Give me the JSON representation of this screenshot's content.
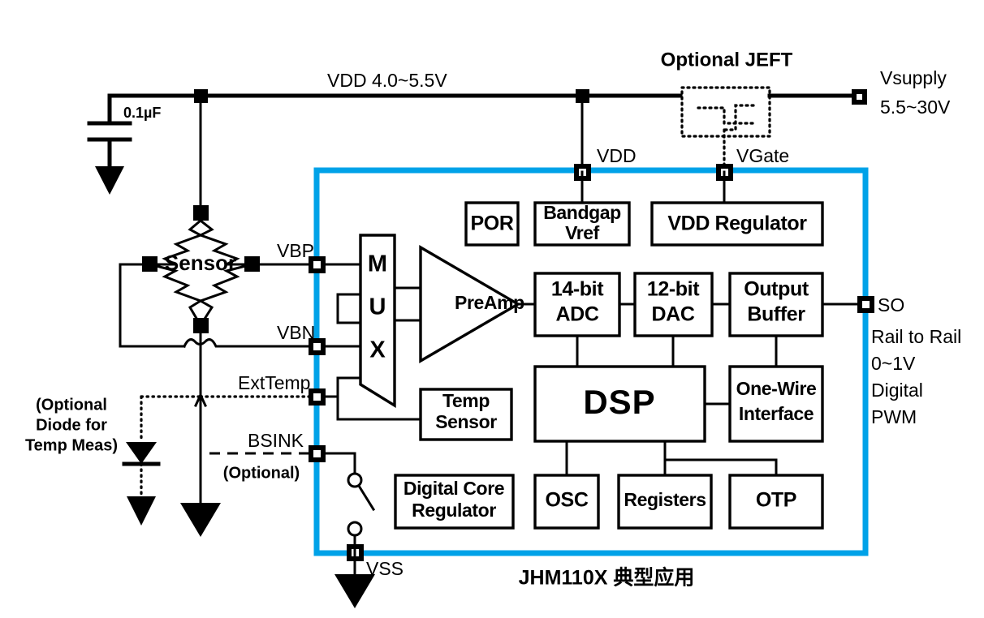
{
  "title": "JHM110X 典型应用",
  "colors": {
    "chip_border": "#00a2e8",
    "wire": "#000000",
    "background": "#ffffff"
  },
  "supply": {
    "vdd_rail_label": "VDD  4.0~5.5V",
    "vdd_pin_label": "VDD",
    "vsupply_label_line1": "Vsupply",
    "vsupply_label_line2": "5.5~30V",
    "cap_label": "0.1µF",
    "jfet_title": "Optional JEFT",
    "vgate_label": "VGate"
  },
  "sensor": {
    "label": "Sensor",
    "vbp_label": "VBP",
    "vbn_label": "VBN",
    "exttemp_label": "ExtTemp",
    "bsink_label": "BSINK",
    "bsink_optional_note": "(Optional)",
    "vss_label": "VSS",
    "diode_note_line1": "(Optional",
    "diode_note_line2": "Diode for",
    "diode_note_line3": "Temp Meas)"
  },
  "output": {
    "so_label": "SO",
    "line2": "Rail to Rail",
    "line3": "0~1V",
    "line4": "Digital",
    "line5": "PWM"
  },
  "mux": {
    "letters": [
      "M",
      "U",
      "X"
    ]
  },
  "preamp": {
    "label": "PreAmp"
  },
  "blocks": [
    {
      "id": "por",
      "label_line1": "POR",
      "label_line2": ""
    },
    {
      "id": "bandgap",
      "label_line1": "Bandgap",
      "label_line2": "Vref"
    },
    {
      "id": "vdd_reg",
      "label_line1": "VDD Regulator",
      "label_line2": ""
    },
    {
      "id": "adc",
      "label_line1": "14-bit",
      "label_line2": "ADC"
    },
    {
      "id": "dac",
      "label_line1": "12-bit",
      "label_line2": "DAC"
    },
    {
      "id": "outbuf",
      "label_line1": "Output",
      "label_line2": "Buffer"
    },
    {
      "id": "tempsensor",
      "label_line1": "Temp",
      "label_line2": "Sensor"
    },
    {
      "id": "dsp",
      "label_line1": "DSP",
      "label_line2": ""
    },
    {
      "id": "onewire",
      "label_line1": "One-Wire",
      "label_line2": "Interface"
    },
    {
      "id": "digcorereg",
      "label_line1": "Digital Core",
      "label_line2": "Regulator"
    },
    {
      "id": "osc",
      "label_line1": "OSC",
      "label_line2": ""
    },
    {
      "id": "registers",
      "label_line1": "Registers",
      "label_line2": ""
    },
    {
      "id": "otp",
      "label_line1": "OTP",
      "label_line2": ""
    }
  ]
}
